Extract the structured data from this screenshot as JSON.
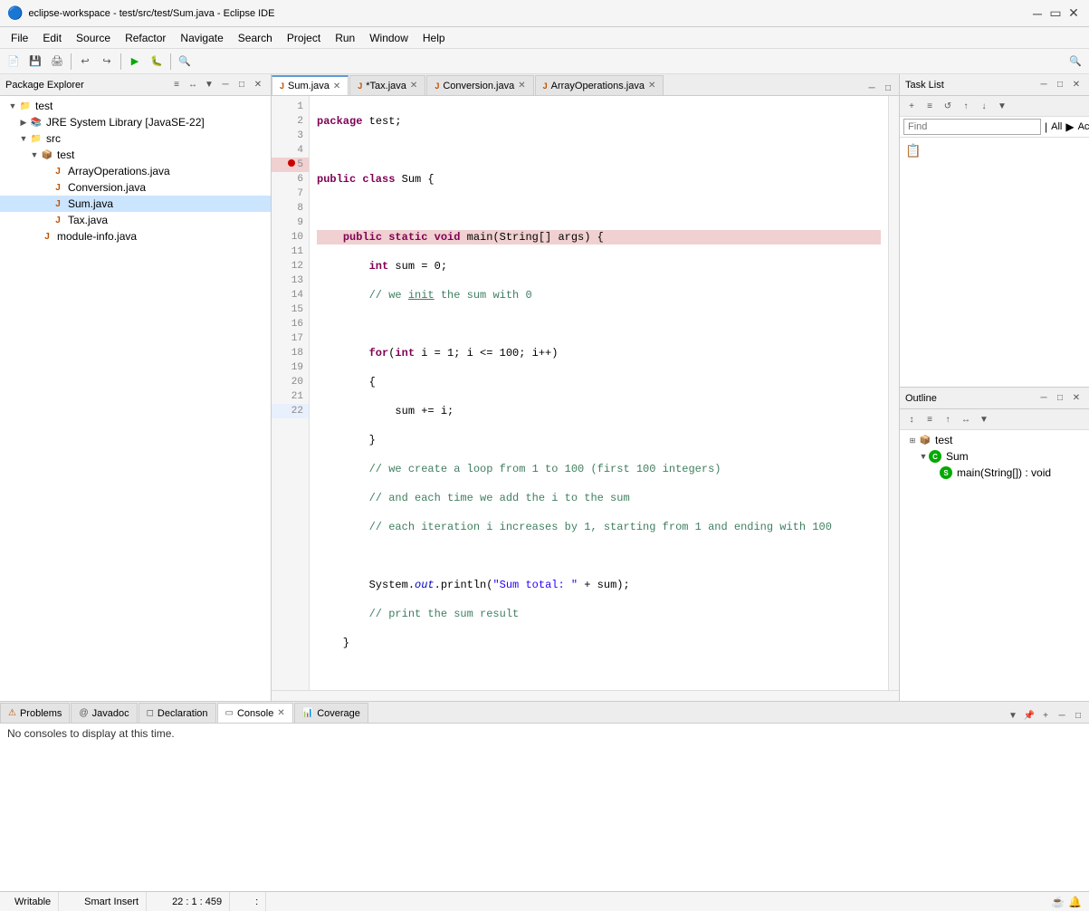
{
  "titleBar": {
    "title": "eclipse-workspace - test/src/test/Sum.java - Eclipse IDE",
    "icon": "eclipse"
  },
  "menuBar": {
    "items": [
      "File",
      "Edit",
      "Source",
      "Refactor",
      "Navigate",
      "Search",
      "Project",
      "Run",
      "Window",
      "Help"
    ]
  },
  "packageExplorer": {
    "title": "Package Explorer",
    "tree": [
      {
        "label": "test",
        "level": 0,
        "type": "project",
        "expanded": true
      },
      {
        "label": "JRE System Library [JavaSE-22]",
        "level": 1,
        "type": "library",
        "expanded": false
      },
      {
        "label": "src",
        "level": 1,
        "type": "folder",
        "expanded": true
      },
      {
        "label": "test",
        "level": 2,
        "type": "package",
        "expanded": true
      },
      {
        "label": "ArrayOperations.java",
        "level": 3,
        "type": "java"
      },
      {
        "label": "Conversion.java",
        "level": 3,
        "type": "java"
      },
      {
        "label": "Sum.java",
        "level": 3,
        "type": "java",
        "selected": true
      },
      {
        "label": "Tax.java",
        "level": 3,
        "type": "java"
      },
      {
        "label": "module-info.java",
        "level": 2,
        "type": "java"
      }
    ]
  },
  "editorTabs": [
    {
      "label": "Sum.java",
      "active": true,
      "modified": false,
      "closeable": true
    },
    {
      "label": "*Tax.java",
      "active": false,
      "modified": true,
      "closeable": true
    },
    {
      "label": "Conversion.java",
      "active": false,
      "modified": false,
      "closeable": true
    },
    {
      "label": "ArrayOperations.java",
      "active": false,
      "modified": false,
      "closeable": true
    }
  ],
  "codeEditor": {
    "lines": [
      {
        "num": 1,
        "code": "package test;",
        "type": "normal"
      },
      {
        "num": 2,
        "code": "",
        "type": "normal"
      },
      {
        "num": 3,
        "code": "public class Sum {",
        "type": "normal"
      },
      {
        "num": 4,
        "code": "",
        "type": "normal"
      },
      {
        "num": 5,
        "code": "    public static void main(String[] args) {",
        "type": "breakpoint"
      },
      {
        "num": 6,
        "code": "        int sum = 0;",
        "type": "normal"
      },
      {
        "num": 7,
        "code": "        // we init the sum with 0",
        "type": "normal"
      },
      {
        "num": 8,
        "code": "",
        "type": "normal"
      },
      {
        "num": 9,
        "code": "        for(int i = 1; i <= 100; i++)",
        "type": "normal"
      },
      {
        "num": 10,
        "code": "        {",
        "type": "normal"
      },
      {
        "num": 11,
        "code": "            sum += i;",
        "type": "normal"
      },
      {
        "num": 12,
        "code": "        }",
        "type": "normal"
      },
      {
        "num": 13,
        "code": "        // we create a loop from 1 to 100 (first 100 integers)",
        "type": "normal"
      },
      {
        "num": 14,
        "code": "        // and each time we add the i to the sum",
        "type": "normal"
      },
      {
        "num": 15,
        "code": "        // each iteration i increases by 1, starting from 1 and ending with 100",
        "type": "normal"
      },
      {
        "num": 16,
        "code": "",
        "type": "normal"
      },
      {
        "num": 17,
        "code": "        System.out.println(\"Sum total: \" + sum);",
        "type": "normal"
      },
      {
        "num": 18,
        "code": "        // print the sum result",
        "type": "normal"
      },
      {
        "num": 19,
        "code": "    }",
        "type": "normal"
      },
      {
        "num": 20,
        "code": "",
        "type": "normal"
      },
      {
        "num": 21,
        "code": "}",
        "type": "normal"
      },
      {
        "num": 22,
        "code": "",
        "type": "highlighted"
      }
    ]
  },
  "taskList": {
    "title": "Task List",
    "findPlaceholder": "Find",
    "filterAll": "All",
    "activateLabel": "Activate..."
  },
  "outline": {
    "title": "Outline",
    "tree": [
      {
        "label": "test",
        "level": 0,
        "type": "package",
        "expanded": true
      },
      {
        "label": "Sum",
        "level": 1,
        "type": "class",
        "expanded": true
      },
      {
        "label": "main(String[]) : void",
        "level": 2,
        "type": "method"
      }
    ]
  },
  "bottomPanel": {
    "tabs": [
      {
        "label": "Problems",
        "active": false,
        "icon": "problems"
      },
      {
        "label": "Javadoc",
        "active": false,
        "icon": "javadoc"
      },
      {
        "label": "Declaration",
        "active": false,
        "icon": "declaration"
      },
      {
        "label": "Console",
        "active": true,
        "icon": "console",
        "closeable": true
      },
      {
        "label": "Coverage",
        "active": false,
        "icon": "coverage"
      }
    ],
    "consoleMessage": "No consoles to display at this time."
  },
  "statusBar": {
    "writable": "Writable",
    "insertMode": "Smart Insert",
    "position": "22 : 1 : 459"
  }
}
